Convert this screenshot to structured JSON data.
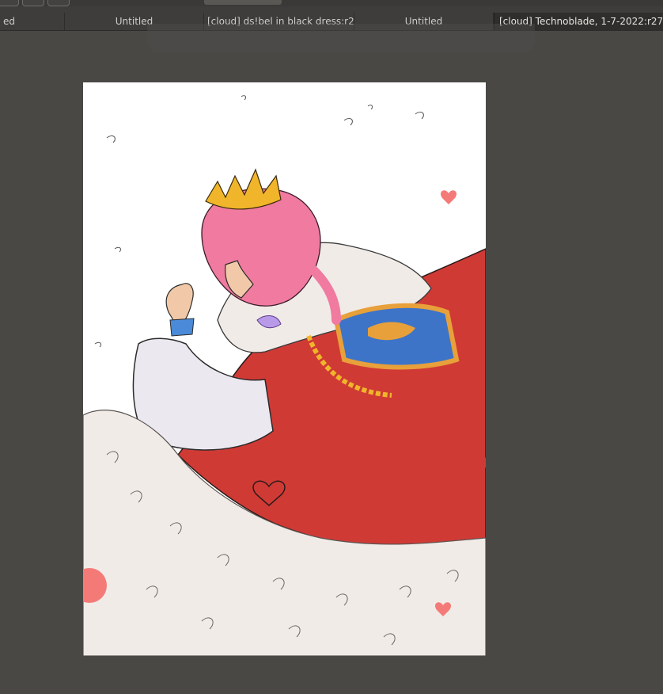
{
  "tabs": [
    {
      "label": "ed"
    },
    {
      "label": "Untitled"
    },
    {
      "label": "[cloud] ds!bel in black dress:r2"
    },
    {
      "label": "Untitled"
    },
    {
      "label": "[cloud] Technoblade, 1-7-2022:r27"
    }
  ],
  "colors": {
    "workspace": "#4a4845",
    "tabbar": "#3f3d3b",
    "active_tab": "#2f2e2c",
    "canvas": "#ffffff",
    "cape_red": "#d03a35",
    "fur": "#f1ebe7",
    "hair_pink": "#f07aa0",
    "crown_gold": "#f0b52a",
    "shield_blue": "#3d74c8",
    "shield_orange": "#e8a03a"
  },
  "canvas_subject": "illustration"
}
